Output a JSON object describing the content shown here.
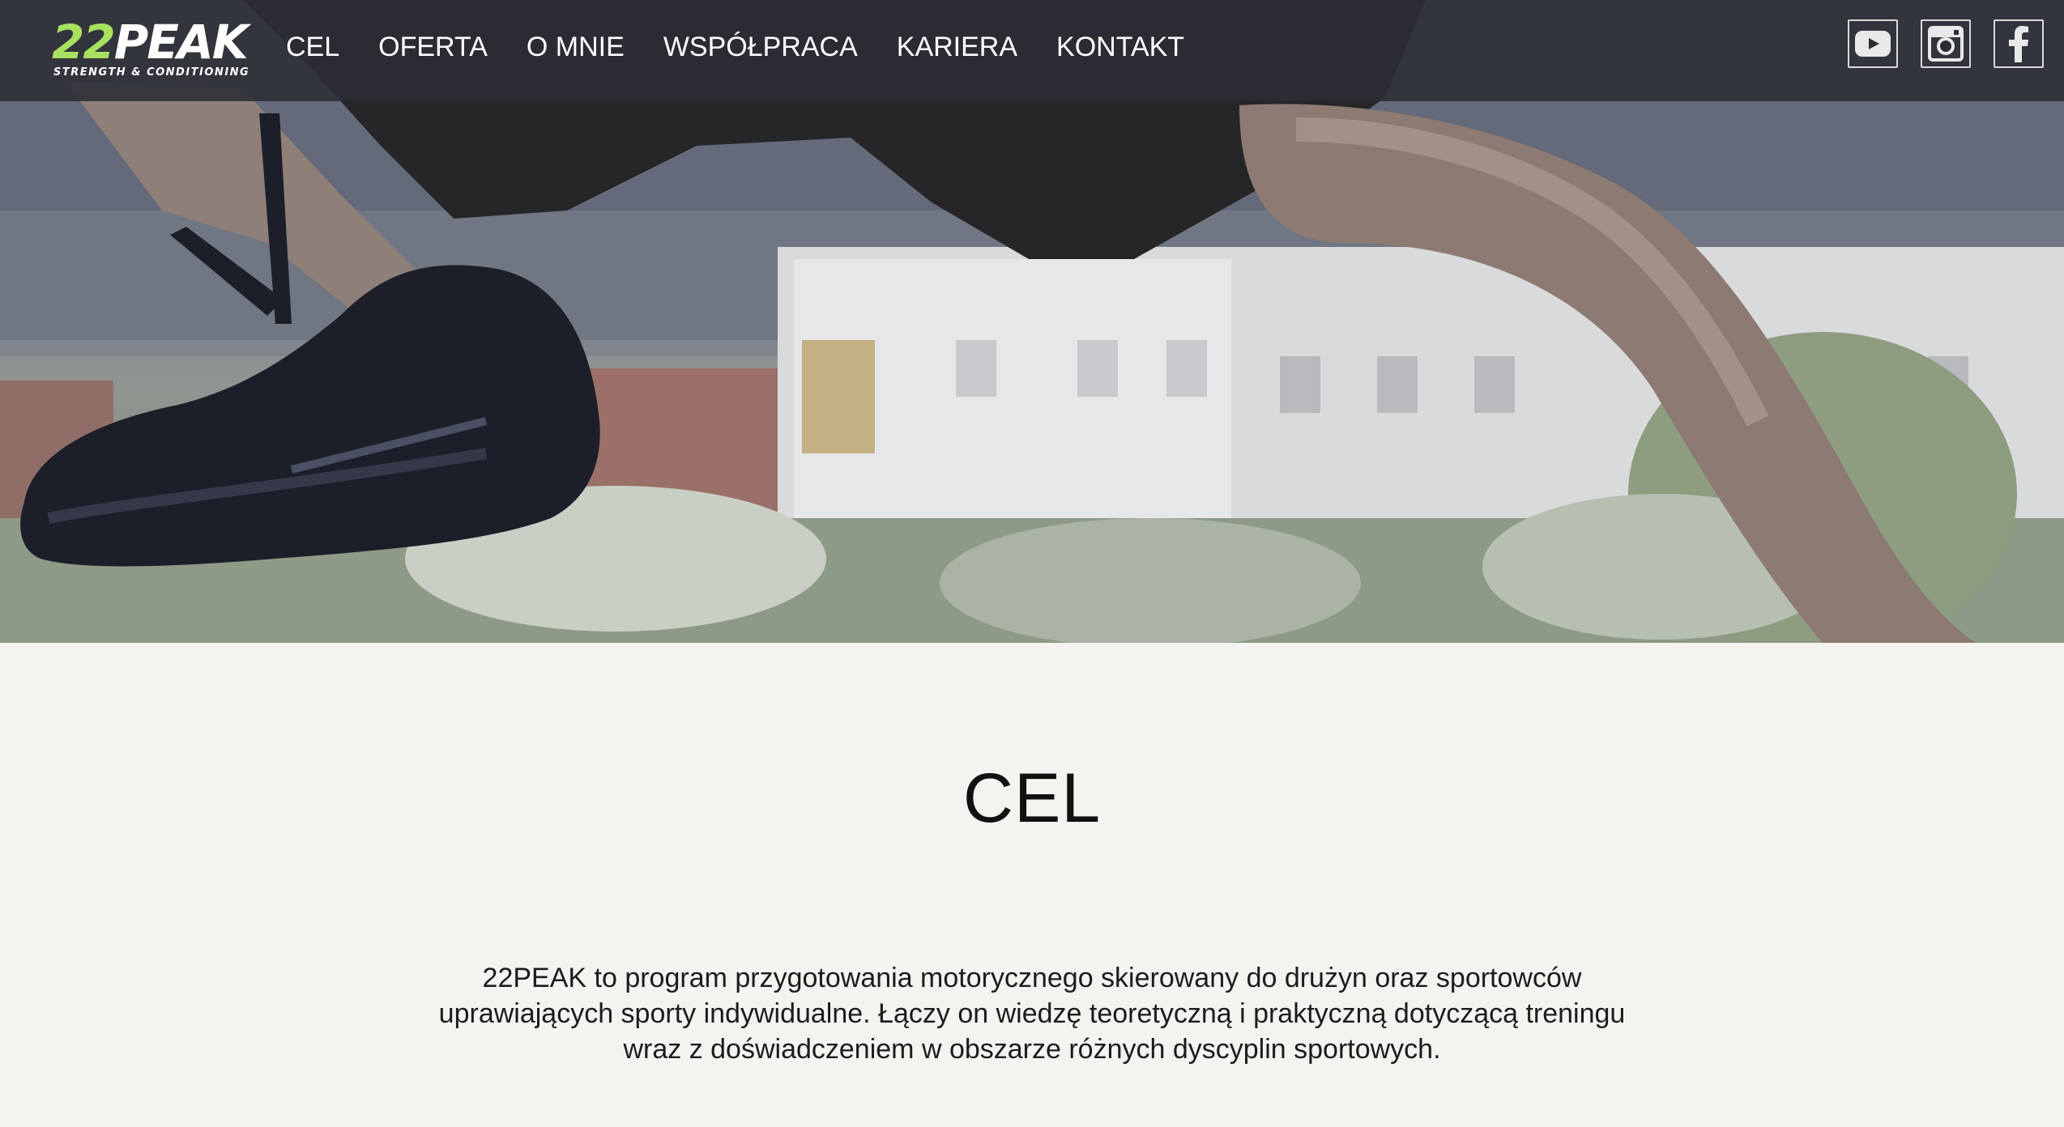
{
  "brand": {
    "logo_number": "22",
    "logo_word": "PEAK",
    "tagline": "STRENGTH & CONDITIONING"
  },
  "nav": {
    "items": [
      "CEL",
      "OFERTA",
      "O MNIE",
      "WSPÓŁPRACA",
      "KARIERA",
      "KONTAKT"
    ]
  },
  "social": {
    "icons": [
      "youtube-icon",
      "instagram-icon",
      "facebook-icon"
    ]
  },
  "colors": {
    "accent": "#a8e05f",
    "navbar": "#2c2d34",
    "content_bg": "#f4f3ef"
  },
  "section": {
    "title": "CEL",
    "text": "22PEAK to program przygotowania motorycznego skierowany do drużyn oraz sportowców uprawiających sporty indywidualne. Łączy on wiedzę teoretyczną i praktyczną dotyczącą treningu wraz z doświadczeniem w obszarze różnych dyscyplin sportowych."
  }
}
